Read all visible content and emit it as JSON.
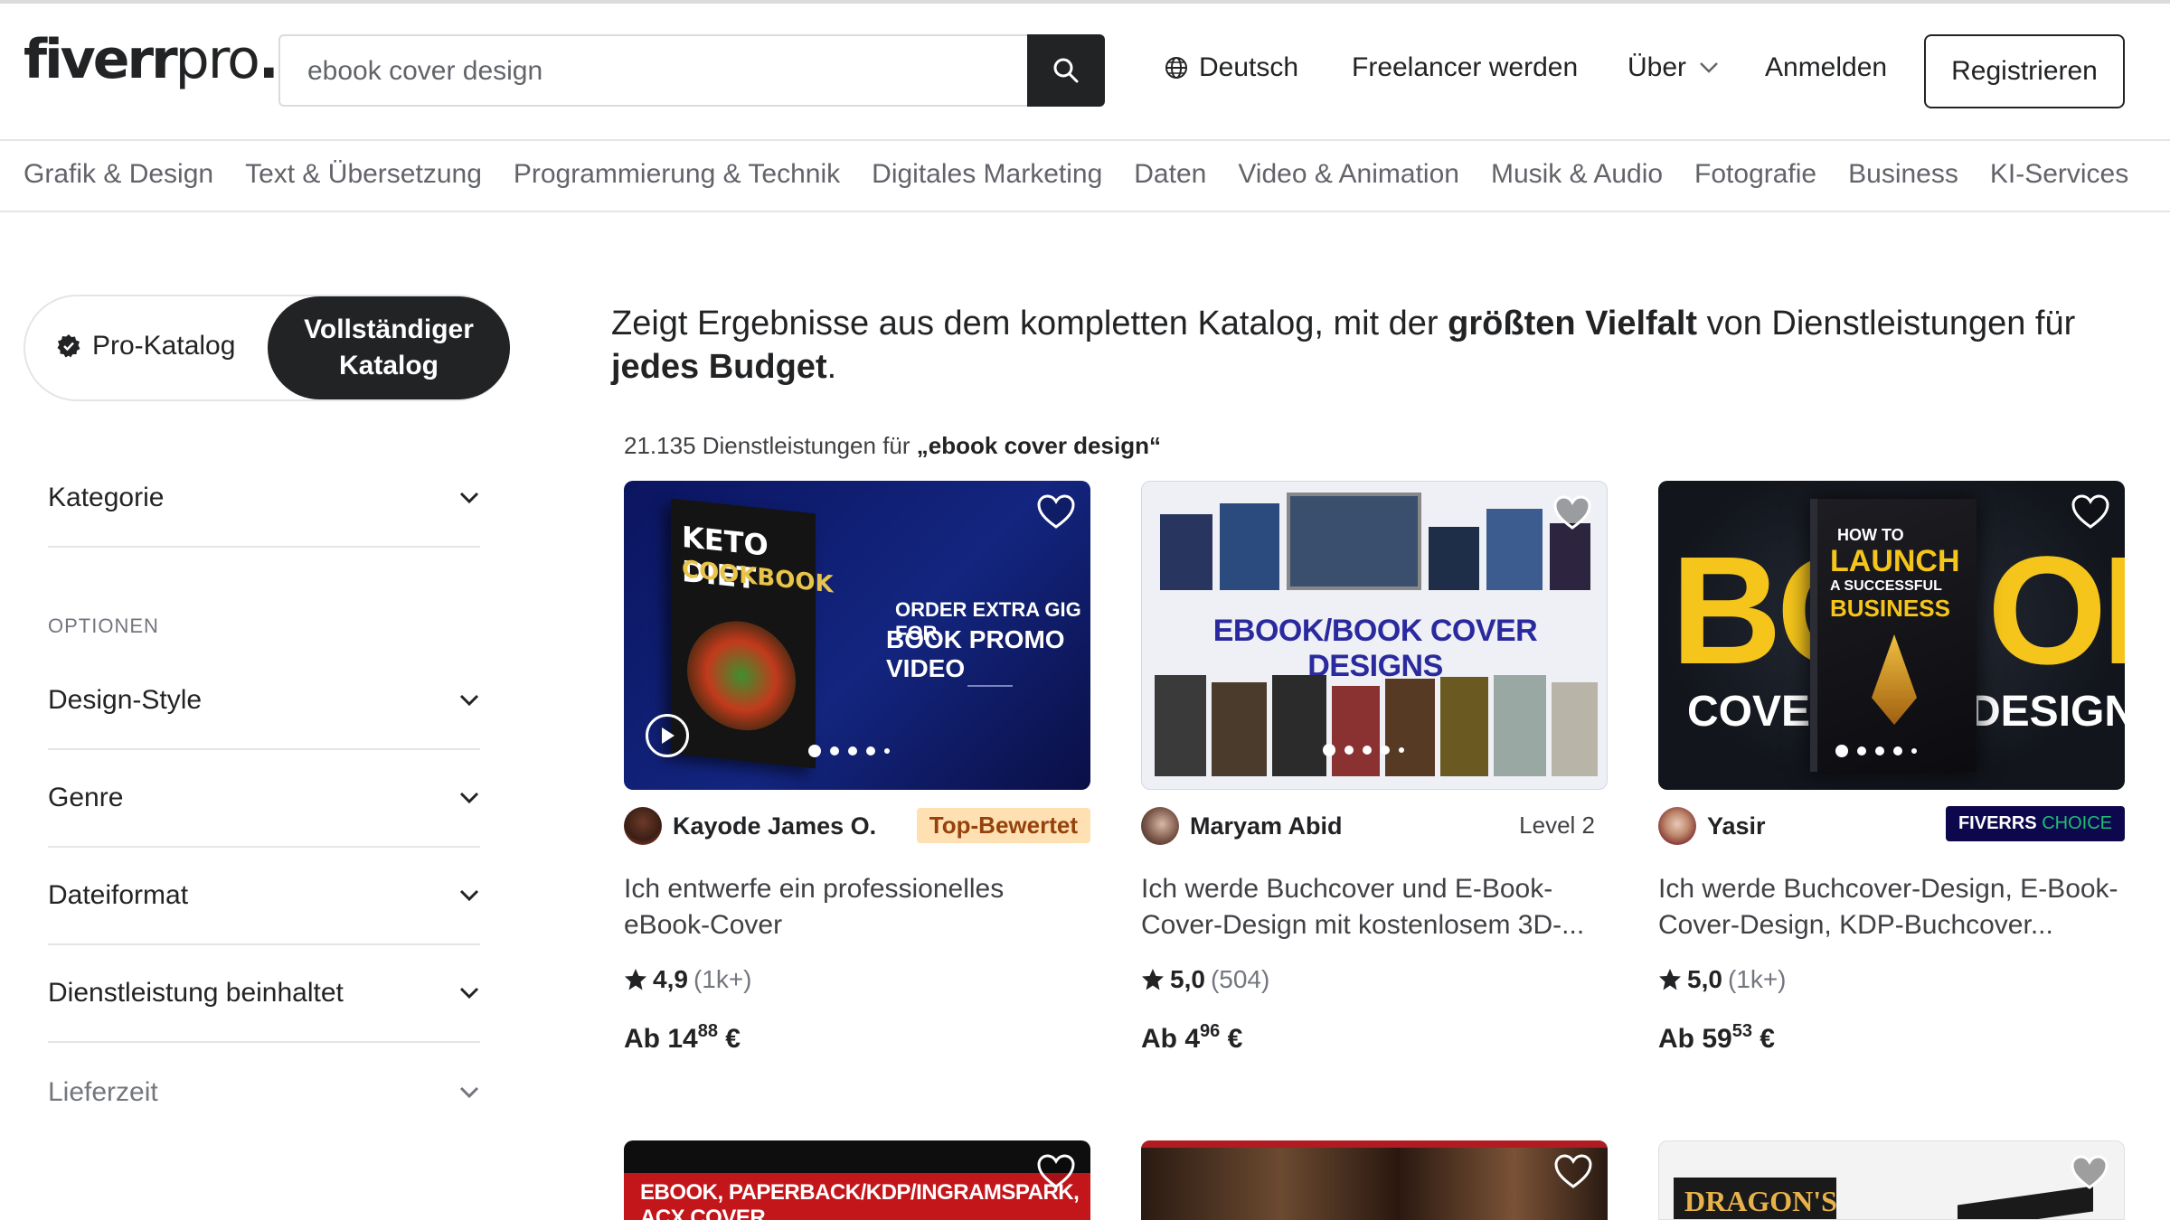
{
  "brand": {
    "logo_main": "fiverr",
    "logo_pro": "pro",
    "logo_dot": "."
  },
  "search": {
    "value": "ebook cover design",
    "icon": "search-icon"
  },
  "header": {
    "language": "Deutsch",
    "become_freelancer": "Freelancer werden",
    "about": "Über",
    "login": "Anmelden",
    "register": "Registrieren"
  },
  "categories": [
    "Grafik & Design",
    "Text & Übersetzung",
    "Programmierung & Technik",
    "Digitales Marketing",
    "Daten",
    "Video & Animation",
    "Musik & Audio",
    "Fotografie",
    "Business",
    "KI-Services"
  ],
  "toggle": {
    "pro": "Pro-Katalog",
    "full_line1": "Vollständiger",
    "full_line2": "Katalog"
  },
  "sidebar": {
    "category": "Kategorie",
    "options_label": "OPTIONEN",
    "filters": [
      "Design-Style",
      "Genre",
      "Dateiformat",
      "Dienstleistung beinhaltet"
    ],
    "delivery": "Lieferzeit"
  },
  "headline": {
    "part1": "Zeigt Ergebnisse aus dem kompletten Katalog, mit der ",
    "bold1": "größten Vielfalt",
    "part2": " von Dienstleistungen für ",
    "bold2": "jedes Budget",
    "part3": "."
  },
  "results": {
    "count_text": "21.135 Dienstleistungen für ",
    "query_text": "„ebook cover design“"
  },
  "cards": [
    {
      "seller": "Kayode James O.",
      "badge": "Top-Bewertet",
      "title": "Ich entwerfe ein professionelles eBook-Cover",
      "rating": "4,9",
      "reviews": "(1k+)",
      "price_prefix": "Ab 14",
      "price_cents": "88",
      "currency": "€",
      "thumb_line1": "KETO DIET",
      "thumb_line2": "COOKBOOK",
      "thumb_line3": "ORDER EXTRA GIG FOR",
      "thumb_line4": "BOOK PROMO VIDEO"
    },
    {
      "seller": "Maryam Abid",
      "badge": "Level 2",
      "title": "Ich werde Buchcover und E-Book-Cover-Design mit kostenlosem 3D-...",
      "rating": "5,0",
      "reviews": "(504)",
      "price_prefix": "Ab 4",
      "price_cents": "96",
      "currency": "€",
      "thumb_line1": "EBOOK/BOOK COVER DESIGNS"
    },
    {
      "seller": "Yasir",
      "badge_main": "FIVERRS",
      "badge_choice": "CHOICE",
      "title": "Ich werde Buchcover-Design, E-Book-Cover-Design, KDP-Buchcover...",
      "rating": "5,0",
      "reviews": "(1k+)",
      "price_prefix": "Ab 59",
      "price_cents": "53",
      "currency": "€",
      "thumb_bo": "BO",
      "thumb_ok": "OK",
      "thumb_cover": "COVER",
      "thumb_design": "DESIGN",
      "thumb_how": "HOW TO",
      "thumb_launch": "LAUNCH",
      "thumb_succ": "A SUCCESSFUL",
      "thumb_business": "BUSINESS"
    }
  ],
  "row2": {
    "banner1": "EBOOK, PAPERBACK/KDP/INGRAMSPARK, ACX COVER",
    "banner3": "DRAGON'S"
  },
  "colors": {
    "accent_green": "#1dbf73",
    "dark": "#222325",
    "badge_top_bg": "#ffe0b3",
    "choice_bg": "#0d084d"
  }
}
